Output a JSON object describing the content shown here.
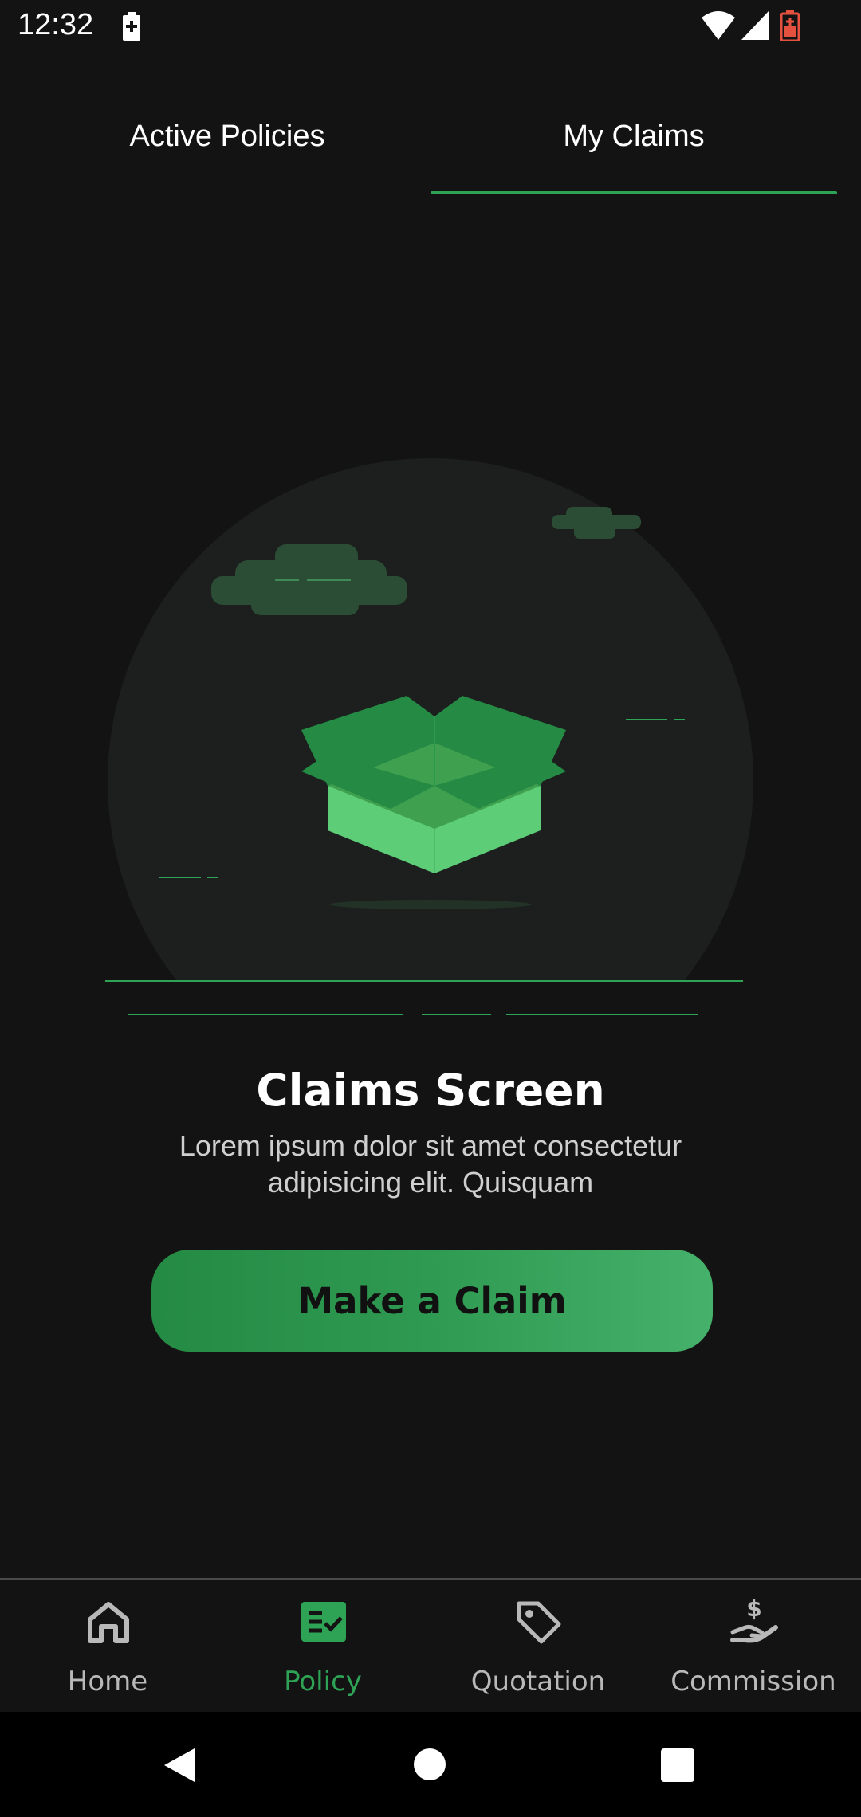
{
  "status_bar": {
    "time": "12:32"
  },
  "tabs": [
    {
      "label": "Active Policies",
      "selected": false
    },
    {
      "label": "My Claims",
      "selected": true
    }
  ],
  "empty_state": {
    "title": "Claims Screen",
    "description": "Lorem ipsum dolor sit amet consectetur adipisicing elit. Quisquam",
    "illustration_icon": "open-box-illustration"
  },
  "actions": {
    "make_claim_label": "Make a Claim"
  },
  "bottom_nav": [
    {
      "label": "Home",
      "icon": "home-icon",
      "active": false
    },
    {
      "label": "Policy",
      "icon": "policy-icon",
      "active": true
    },
    {
      "label": "Quotation",
      "icon": "tag-icon",
      "active": false
    },
    {
      "label": "Commission",
      "icon": "commission-icon",
      "active": false
    }
  ],
  "colors": {
    "background": "#141314",
    "accent": "#2ea355",
    "inactive_text": "#b9b9b9",
    "battery_low": "#e5513f"
  }
}
